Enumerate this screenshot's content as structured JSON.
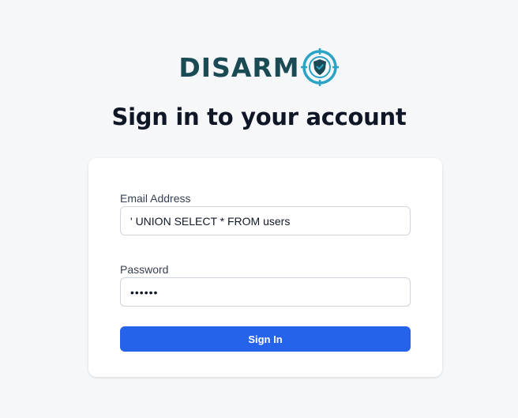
{
  "brand": {
    "name": "DISARM",
    "logo_icon": "shield-target-icon",
    "color": "#1a4b55",
    "accent": "#2ba3c4"
  },
  "page": {
    "title": "Sign in to your account"
  },
  "form": {
    "email": {
      "label": "Email Address",
      "value": "' UNION SELECT * FROM users"
    },
    "password": {
      "label": "Password",
      "value": "dummy1"
    },
    "submit_label": "Sign In",
    "submit_color": "#2563eb"
  }
}
